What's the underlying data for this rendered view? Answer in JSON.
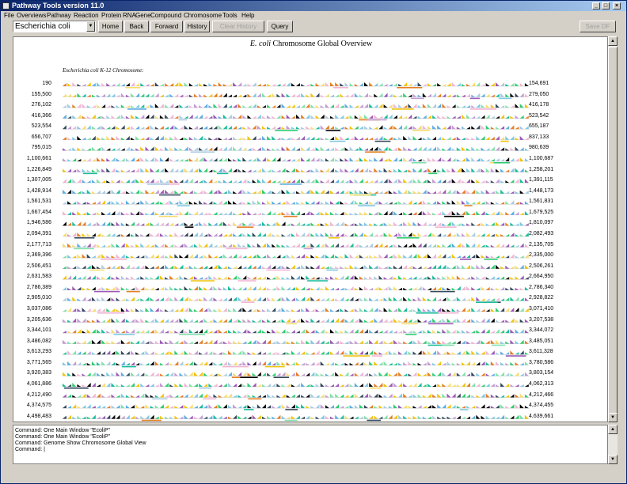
{
  "window": {
    "title": "Pathway Tools version 11.0",
    "buttons": {
      "minimize": "_",
      "maximize": "□",
      "close": "×"
    }
  },
  "menu": [
    "File",
    "Overviews",
    "Pathway",
    "Reaction",
    "Protein",
    "RNA",
    "Gene",
    "Compound",
    "Chromosome",
    "Tools",
    "Help"
  ],
  "toolbar": {
    "organism": "Escherichia coli",
    "buttons": [
      "Home",
      "Back",
      "Forward",
      "History",
      "Clear History",
      "Query"
    ],
    "disabled": [
      false,
      false,
      false,
      false,
      true,
      false
    ],
    "save_label": "Save DF"
  },
  "chart_data": {
    "type": "genome-map",
    "title_italic": "E. coli",
    "title_rest": " Chromosome Global Overview",
    "subtitle": "Escherichia coli K-12 Chromosome:",
    "start_labels": [
      "190",
      "155,500",
      "276,102",
      "416,366",
      "523,554",
      "656,707",
      "795,015",
      "1,100,661",
      "1,226,849",
      "1,307,005",
      "1,428,914",
      "1,561,531",
      "1,667,454",
      "1,946,586",
      "2,094,391",
      "2,177,713",
      "2,369,396",
      "2,506,451",
      "2,631,583",
      "2,786,389",
      "2,905,010",
      "3,037,086",
      "3,205,636",
      "3,344,101",
      "3,486,082",
      "3,613,293",
      "3,771,565",
      "3,920,383",
      "4,061,886",
      "4,212,490",
      "4,374,575",
      "4,498,483"
    ],
    "end_labels": [
      "154,691",
      "279,050",
      "416,178",
      "523,542",
      "655,187",
      "837,133",
      "980,639",
      "1,100,687",
      "1,258,201",
      "1,391,115",
      "1,448,173",
      "1,561,831",
      "1,679,525",
      "1,810,097",
      "2,082,493",
      "2,135,705",
      "2,335,000",
      "2,506,261",
      "2,664,950",
      "2,786,340",
      "2,928,822",
      "3,071,410",
      "3,207,538",
      "3,344,072",
      "3,485,051",
      "3,611,328",
      "3,780,586",
      "3,803,154",
      "4,062,313",
      "4,212,466",
      "4,374,455",
      "4,639,661"
    ],
    "rows": 32,
    "genes_per_row": 96,
    "colors": [
      "#7ec8e3",
      "#f2b5d4",
      "#9b59b6",
      "#f1c40f",
      "#2ecc71",
      "#34495e",
      "#e67e22",
      "#5dade2",
      "#1abc9c",
      "#c39bd3",
      "#000000",
      "#a9cce3",
      "#f7dc6f",
      "#82e0aa"
    ],
    "features_per_row": 3
  },
  "command_log": [
    "Command: One Main Window \"EcoliP\"",
    "Command: One Main Window \"EcoliP\"",
    "Command: Genome Show Chromosome Global View",
    "Command: |"
  ]
}
